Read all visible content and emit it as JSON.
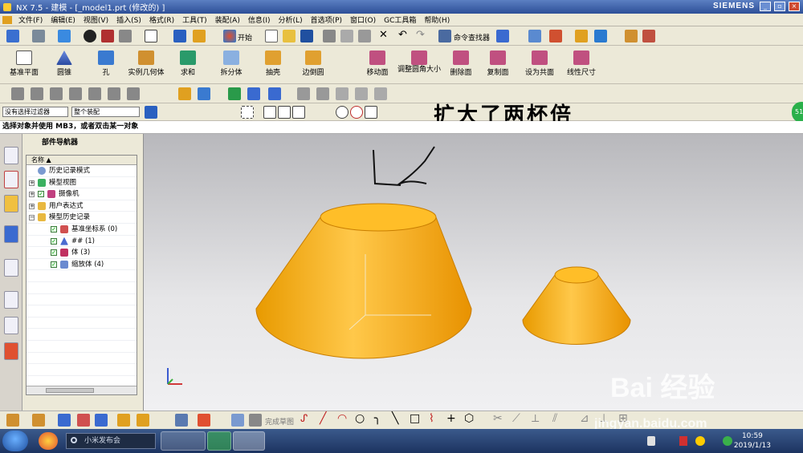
{
  "window": {
    "title": "NX 7.5 - 建模 - [_model1.prt (修改的) ]",
    "brand": "SIEMENS",
    "minimize": "_",
    "restore": "▫",
    "close": "×"
  },
  "menu": [
    "文件(F)",
    "编辑(E)",
    "视图(V)",
    "插入(S)",
    "格式(R)",
    "工具(T)",
    "装配(A)",
    "信息(I)",
    "分析(L)",
    "首选项(P)",
    "窗口(O)",
    "GC工具箱",
    "帮助(H)"
  ],
  "toolbar1": {
    "start_label": "开始",
    "command_finder_label": "命令查找器"
  },
  "feature_buttons": [
    "基准平面",
    "圆锥",
    "孔",
    "实例几何体",
    "求和",
    "拆分体",
    "抽壳",
    "边倒圆"
  ],
  "sync_buttons": [
    "移动面",
    "调整圆角大小",
    "删除面",
    "复制面",
    "设为共面",
    "线性尺寸"
  ],
  "selection": {
    "filter": "没有选择过滤器",
    "scope": "整个装配"
  },
  "annotation_text": "扩大了两杯倍",
  "status_prompt": "选择对象并使用 MB3，或者双击某一对象",
  "navigator": {
    "title": "部件导航器",
    "column_name": "名称",
    "items": [
      {
        "label": "历史记录模式",
        "level": 0
      },
      {
        "label": "模型视图",
        "level": 0
      },
      {
        "label": "摄像机",
        "level": 0
      },
      {
        "label": "用户表达式",
        "level": 0
      },
      {
        "label": "模型历史记录",
        "level": 0
      },
      {
        "label": "基准坐标系 (0)",
        "level": 1
      },
      {
        "label": "## (1)",
        "level": 1
      },
      {
        "label": "体 (3)",
        "level": 1
      },
      {
        "label": "缩放体 (4)",
        "level": 1
      }
    ]
  },
  "sketch_toolbar": {
    "finish_sketch": "完成草图"
  },
  "taskbar": {
    "search_placeholder": "小米发布会",
    "time": "10:59",
    "date": "2019/1/13"
  },
  "watermark": {
    "brand": "Bai 经验",
    "url": "jingyan.baidu.com"
  },
  "colors": {
    "cone": "#ffb820",
    "cone_edge": "#c87d00",
    "viewport_top": "#b8b8bc"
  }
}
